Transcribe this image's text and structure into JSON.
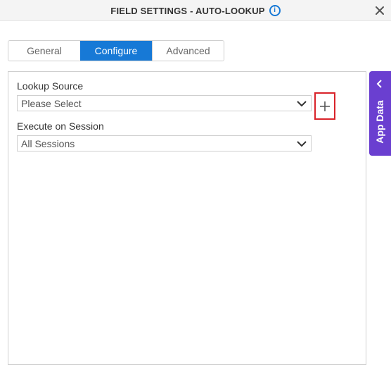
{
  "header": {
    "title": "FIELD SETTINGS - AUTO-LOOKUP",
    "info_icon": "info-icon",
    "close_icon": "close-icon"
  },
  "tabs": [
    {
      "label": "General",
      "active": false
    },
    {
      "label": "Configure",
      "active": true
    },
    {
      "label": "Advanced",
      "active": false
    }
  ],
  "form": {
    "lookup_source": {
      "label": "Lookup Source",
      "value": "Please Select",
      "add_icon": "plus-icon"
    },
    "execute_on_session": {
      "label": "Execute on Session",
      "value": "All Sessions"
    }
  },
  "side_panel": {
    "label": "App Data",
    "icon": "chevron-left-icon"
  },
  "colors": {
    "accent": "#1779d6",
    "app_data": "#6a3fd0",
    "highlight": "#d9232a"
  }
}
